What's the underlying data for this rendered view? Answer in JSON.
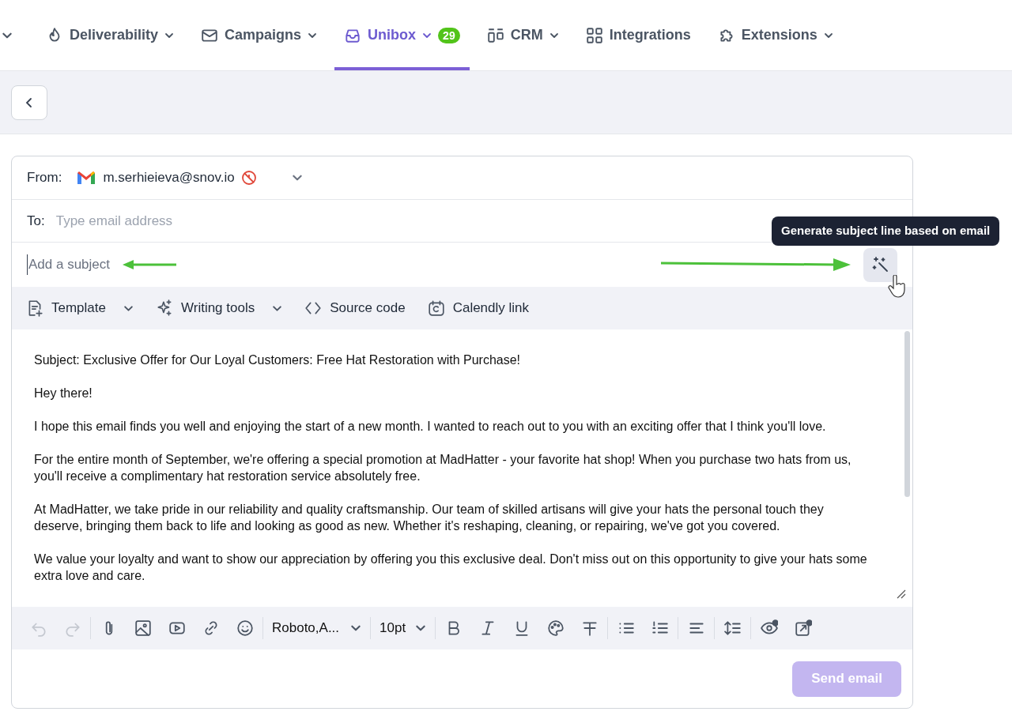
{
  "nav": {
    "items": [
      {
        "label": "Deliverability",
        "dropdown": true,
        "selected": false
      },
      {
        "label": "Campaigns",
        "dropdown": true,
        "selected": false
      },
      {
        "label": "Unibox",
        "dropdown": true,
        "selected": true,
        "badge": "29"
      },
      {
        "label": "CRM",
        "dropdown": true,
        "selected": false
      },
      {
        "label": "Integrations",
        "dropdown": false,
        "selected": false
      },
      {
        "label": "Extensions",
        "dropdown": true,
        "selected": false
      }
    ]
  },
  "compose": {
    "from": {
      "label": "From:",
      "email": "m.serhieieva@snov.io"
    },
    "to": {
      "label": "To:",
      "placeholder": "Type email address"
    },
    "subject": {
      "placeholder": "Add a subject"
    },
    "tooltip": "Generate subject line based on email",
    "tools": [
      {
        "label": "Template",
        "dropdown": true
      },
      {
        "label": "Writing tools",
        "dropdown": true
      },
      {
        "label": "Source code",
        "dropdown": false
      },
      {
        "label": "Calendly link",
        "dropdown": false
      }
    ],
    "body": [
      "Subject: Exclusive Offer for Our Loyal Customers: Free Hat Restoration with Purchase!",
      "Hey there!",
      "I hope this email finds you well and enjoying the start of a new month. I wanted to reach out to you with an exciting offer that I think you'll love.",
      "For the entire month of September, we're offering a special promotion at MadHatter - your favorite hat shop! When you purchase two hats from us, you'll receive a complimentary hat restoration service absolutely free.",
      "At MadHatter, we take pride in our reliability and quality craftsmanship. Our team of skilled artisans will give your hats the personal touch they deserve, bringing them back to life and looking as good as new. Whether it's reshaping, cleaning, or repairing, we've got you covered.",
      "We value your loyalty and want to show our appreciation by offering you this exclusive deal. Don't miss out on this opportunity to give your hats some extra love and care."
    ],
    "format": {
      "undo_disabled": true,
      "redo_disabled": true,
      "font": "Roboto,A...",
      "size": "10pt"
    },
    "send": {
      "label": "Send email",
      "disabled": true
    }
  }
}
